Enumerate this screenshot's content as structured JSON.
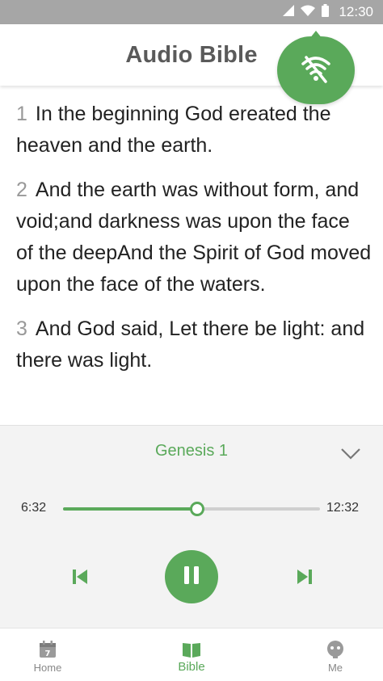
{
  "status_bar": {
    "time": "12:30"
  },
  "header": {
    "title": "Audio Bible"
  },
  "verses": [
    {
      "num": "1",
      "text": "In the beginning God ereated the heaven and the earth."
    },
    {
      "num": "2",
      "text": "And the earth was without form, and void;and darkness was upon the face of the deepAnd the Spirit of God moved upon the face of the waters."
    },
    {
      "num": "3",
      "text": "And God said, Let there be light: and there was light."
    }
  ],
  "player": {
    "track": "Genesis 1",
    "elapsed": "6:32",
    "total": "12:32",
    "progress_fraction": 0.52
  },
  "nav": {
    "items": [
      {
        "label": "Home",
        "icon": "calendar-icon"
      },
      {
        "label": "Bible",
        "icon": "book-icon",
        "active": true
      },
      {
        "label": "Me",
        "icon": "profile-icon"
      }
    ]
  },
  "colors": {
    "accent": "#5aa95a",
    "status_bar": "#a6a6a6",
    "nav_inactive": "#888888"
  }
}
